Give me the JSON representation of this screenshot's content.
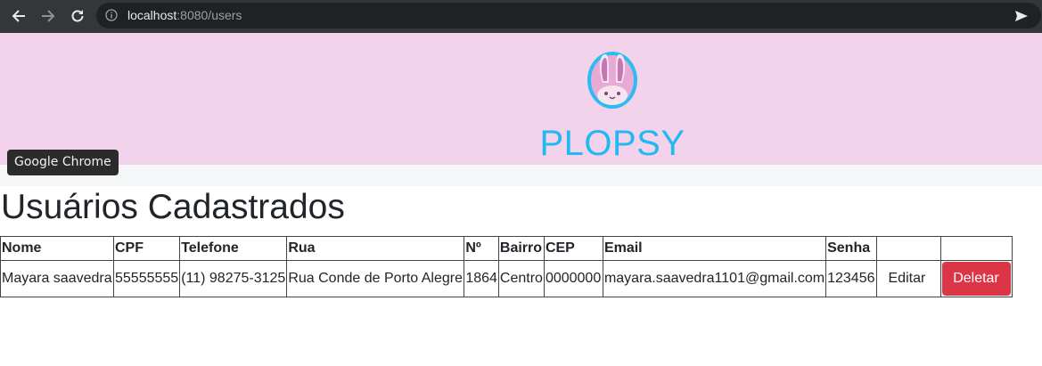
{
  "browser": {
    "url_host": "localhost",
    "url_path": ":8080/users",
    "tooltip": "Google Chrome",
    "icons": [
      "back-arrow-icon",
      "forward-arrow-icon",
      "reload-icon",
      "info-icon",
      "send-icon"
    ]
  },
  "header": {
    "brand": "PLOPSY",
    "logo_icon": "bunny-logo-icon",
    "brand_color": "#22b8f0",
    "background": "#f2d3eb"
  },
  "page": {
    "title": "Usuários Cadastrados"
  },
  "table": {
    "columns": [
      "Nome",
      "CPF",
      "Telefone",
      "Rua",
      "Nº",
      "Bairro",
      "CEP",
      "Email",
      "Senha",
      ""
    ],
    "rows": [
      {
        "nome": "Mayara saavedra",
        "cpf": "55555555",
        "telefone": "(11) 98275-3125",
        "rua": "Rua Conde de Porto Alegre",
        "numero": "1864",
        "bairro": "Centro",
        "cep": "0000000",
        "email": "mayara.saavedra1101@gmail.com",
        "senha": "123456",
        "edit_label": "Editar",
        "delete_label": "Deletar"
      }
    ],
    "delete_color": "#dc3545"
  }
}
